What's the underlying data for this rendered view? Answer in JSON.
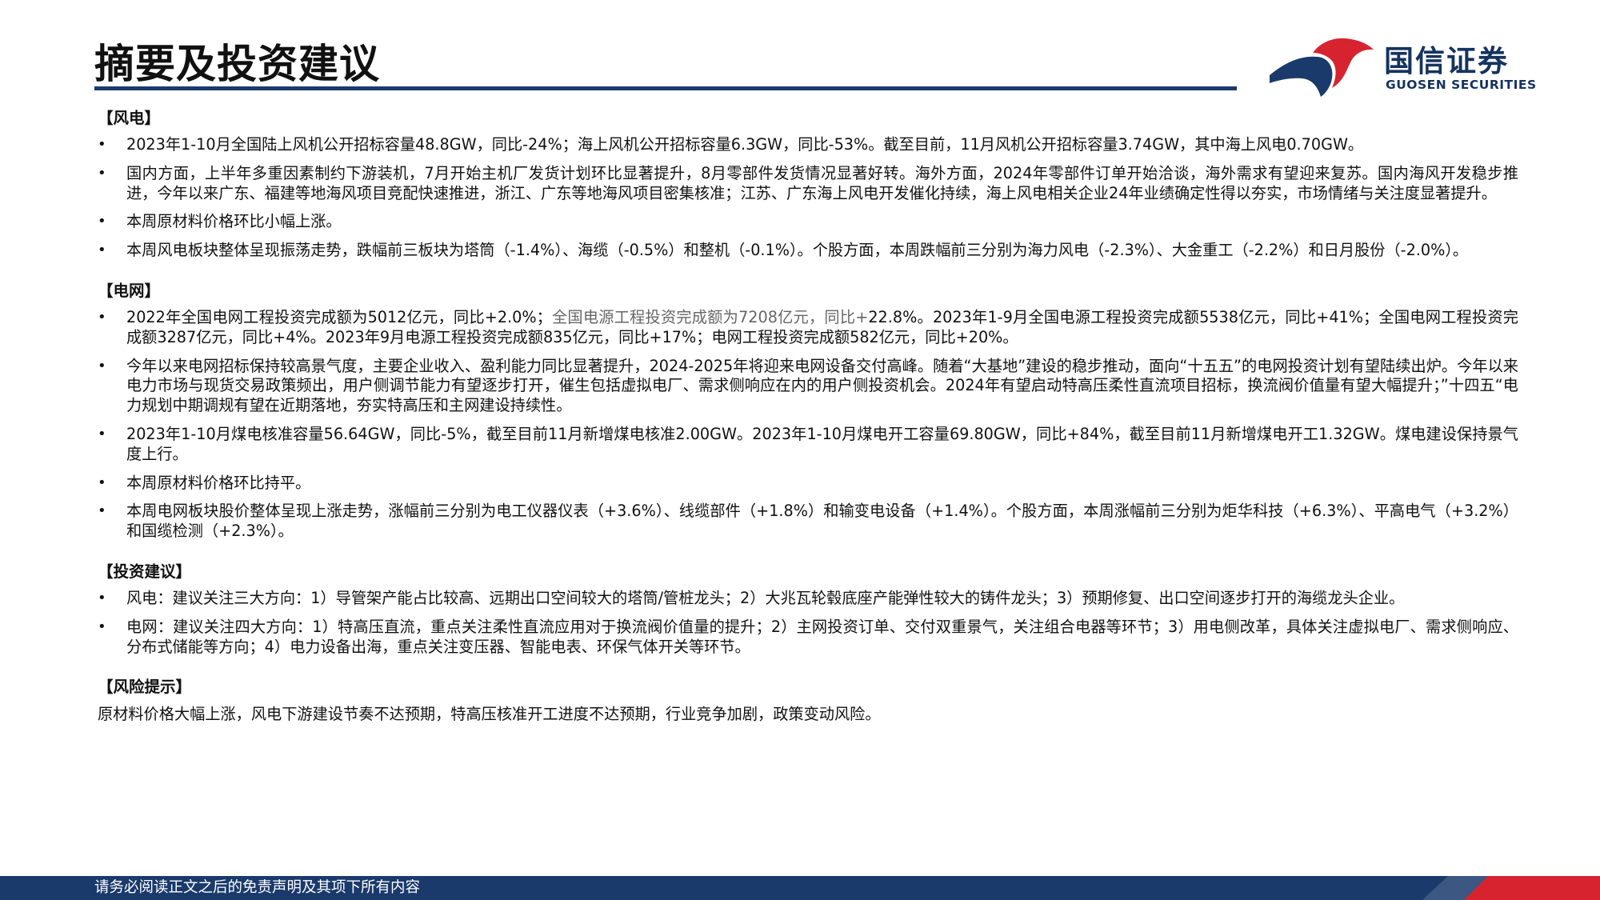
{
  "page_title": "摘要及投资建议",
  "logo": {
    "name_cn": "国信证券",
    "name_en": "GUOSEN SECURITIES"
  },
  "colors": {
    "navy": "#1a3a6b",
    "red": "#d7232f",
    "muted_text": "#666666"
  },
  "sections": [
    {
      "header": "【风电】",
      "bullets": [
        [
          "2023年1-10月全国陆上风机公开招标容量48.8GW，同比-24%；海上风机公开招标容量6.3GW，同比-53%。截至目前，11月风机公开招标容量3.74GW，其中海上风电0.70GW。"
        ],
        [
          "国内方面，上半年多重因素制约下游装机，7月开始主机厂发货计划环比显著提升，8月零部件发货情况显著好转。海外方面，2024年零部件订单开始洽谈，海外需求有望迎来复苏。国内海风开发稳步推进，今年以来广东、福建等地海风项目竞配快速推进，浙江、广东等地海风项目密集核准；江苏、广东海上风电开发催化持续，海上风电相关企业24年业绩确定性得以夯实，市场情绪与关注度显著提升。"
        ],
        [
          "本周原材料价格环比小幅上涨。"
        ],
        [
          "本周风电板块整体呈现振荡走势，跌幅前三板块为塔筒（-1.4%）、海缆（-0.5%）和整机（-0.1%）。个股方面，本周跌幅前三分别为海力风电（-2.3%）、大金重工（-2.2%）和日月股份（-2.0%）。"
        ]
      ]
    },
    {
      "header": "【电网】",
      "bullets": [
        [
          "2022年全国电网工程投资完成额为5012亿元，同比+2.0%；",
          "全国电源工程投资完成额为7208亿元，同比+",
          "22.8%。2023年1-9月全国电源工程投资完成额5538亿元，同比+41%；全国电网工程投资完成额3287亿元，同比+4%。2023年9月电源工程投资完成额835亿元，同比+17%；电网工程投资完成额582亿元，同比+20%。"
        ],
        [
          "今年以来电网招标保持较高景气度，主要企业收入、盈利能力同比显著提升，2024-2025年将迎来电网设备交付高峰。随着“大基地”建设的稳步推动，面向“十五五”的电网投资计划有望陆续出炉。今年以来电力市场与现货交易政策频出，用户侧调节能力有望逐步打开，催生包括虚拟电厂、需求侧响应在内的用户侧投资机会。2024年有望启动特高压柔性直流项目招标，换流阀价值量有望大幅提升；”十四五“电力规划中期调规有望在近期落地，夯实特高压和主网建设持续性。"
        ],
        [
          "2023年1-10月煤电核准容量56.64GW，同比-5%，截至目前11月新增煤电核准2.00GW。2023年1-10月煤电开工容量69.80GW，同比+84%，截至目前11月新增煤电开工1.32GW。煤电建设保持景气度上行。"
        ],
        [
          "本周原材料价格环比持平。"
        ],
        [
          "本周电网板块股价整体呈现上涨走势，涨幅前三分别为电工仪器仪表（+3.6%）、线缆部件（+1.8%）和输变电设备（+1.4%）。个股方面，本周涨幅前三分别为炬华科技（+6.3%）、平高电气（+3.2%）和国缆检测（+2.3%）。"
        ]
      ]
    },
    {
      "header": "【投资建议】",
      "bullets": [
        [
          "风电：建议关注三大方向：1）导管架产能占比较高、远期出口空间较大的塔筒/管桩龙头；2）大兆瓦轮毂底座产能弹性较大的铸件龙头；3）预期修复、出口空间逐步打开的海缆龙头企业。"
        ],
        [
          "电网：建议关注四大方向：1）特高压直流，重点关注柔性直流应用对于换流阀价值量的提升；2）主网投资订单、交付双重景气，关注组合电器等环节；3）用电侧改革，具体关注虚拟电厂、需求侧响应、分布式储能等方向；4）电力设备出海，重点关注变压器、智能电表、环保气体开关等环节。"
        ]
      ]
    }
  ],
  "risk": {
    "header": "【风险提示】",
    "text": "原材料价格大幅上涨，风电下游建设节奏不达预期，特高压核准开工进度不达预期，行业竞争加剧，政策变动风险。"
  },
  "footer": {
    "disclaimer": "请务必阅读正文之后的免责声明及其项下所有内容"
  }
}
